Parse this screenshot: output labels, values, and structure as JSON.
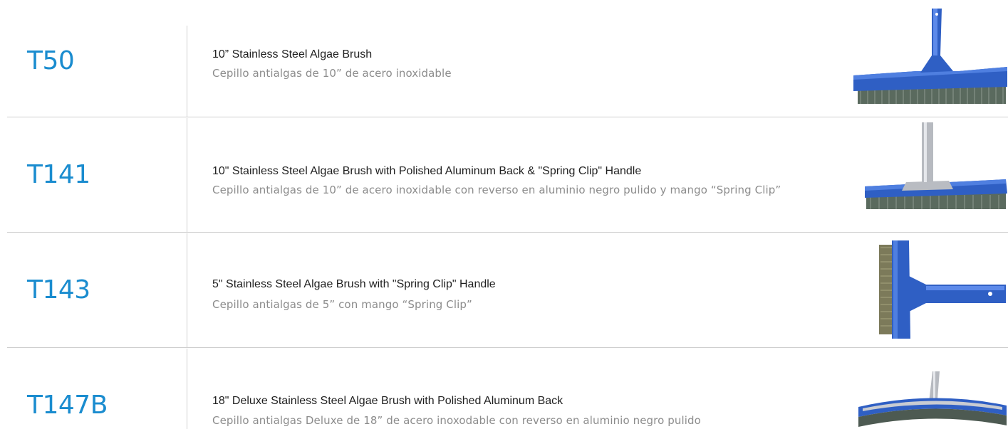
{
  "products": [
    {
      "code": "T50",
      "name_en": "10” Stainless Steel Algae Brush",
      "name_es": "Cepillo antialgas de 10” de acero inoxidable",
      "image_icon": "blue-wall-brush-with-blue-handle"
    },
    {
      "code": "T141",
      "name_en": "10\" Stainless Steel Algae Brush with Polished Aluminum Back & \"Spring Clip\" Handle",
      "name_es": "Cepillo antialgas de 10” de acero inoxidable con reverso en aluminio negro pulido y mango “Spring Clip”",
      "image_icon": "blue-wall-brush-with-aluminum-handle"
    },
    {
      "code": "T143",
      "name_en": "5\" Stainless Steel Algae Brush with \"Spring Clip\" Handle",
      "name_es": "Cepillo antialgas de 5” con mango “Spring Clip”",
      "image_icon": "small-blue-algae-brush"
    },
    {
      "code": "T147B",
      "name_en": "18\" Deluxe Stainless Steel Algae Brush with Polished Aluminum Back",
      "name_es": "Cepillo antialgas Deluxe de 18” de acero inoxodable con reverso en aluminio negro pulido",
      "image_icon": "curved-deluxe-wall-brush"
    }
  ],
  "colors": {
    "code_blue": "#1a8ccf",
    "brush_blue": "#2f5fc4",
    "divider": "#cfcfcf"
  }
}
